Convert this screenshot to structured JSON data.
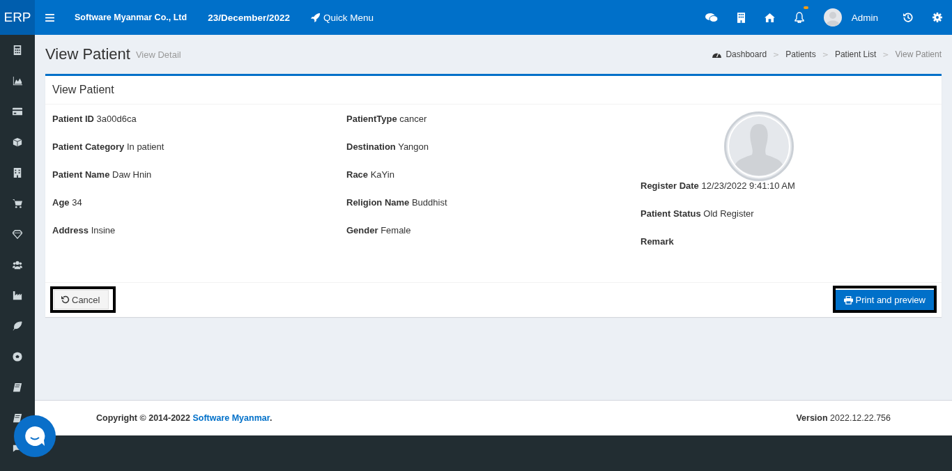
{
  "topbar": {
    "logo": "ERP",
    "company": "Software Myanmar Co., Ltd",
    "date": "23/December/2022",
    "quick_menu": "Quick Menu",
    "user": "Admin",
    "notification_badge": true
  },
  "page": {
    "title": "View Patient",
    "subtitle": "View Detail",
    "breadcrumb_separator": ">",
    "breadcrumb": [
      {
        "label": "Dashboard",
        "current": false
      },
      {
        "label": "Patients",
        "current": false
      },
      {
        "label": "Patient List",
        "current": false
      },
      {
        "label": "View Patient",
        "current": true
      }
    ]
  },
  "card": {
    "title": "View Patient",
    "columns": [
      [
        {
          "label": "Patient ID",
          "value": "3a00d6ca"
        },
        {
          "label": "Patient Category",
          "value": "In patient"
        },
        {
          "label": "Patient Name",
          "value": "Daw Hnin"
        },
        {
          "label": "Age",
          "value": "34"
        },
        {
          "label": "Address",
          "value": "Insine"
        }
      ],
      [
        {
          "label": "PatientType",
          "value": "cancer"
        },
        {
          "label": "Destination",
          "value": "Yangon"
        },
        {
          "label": "Race",
          "value": "KaYin"
        },
        {
          "label": "Religion Name",
          "value": "Buddhist"
        },
        {
          "label": "Gender",
          "value": "Female"
        }
      ],
      [
        {
          "label": "Register Date",
          "value": "12/23/2022 9:41:10 AM"
        },
        {
          "label": "Patient Status",
          "value": "Old Register"
        },
        {
          "label": "Remark"
        }
      ]
    ],
    "cancel_button": "Cancel",
    "print_button": "Print and preview"
  },
  "footer": {
    "copyright": "Copyright © 2014-2022 ",
    "link": "Software Myanmar",
    "suffix": ".",
    "version_label": "Version",
    "version": "2022.12.22.756"
  }
}
